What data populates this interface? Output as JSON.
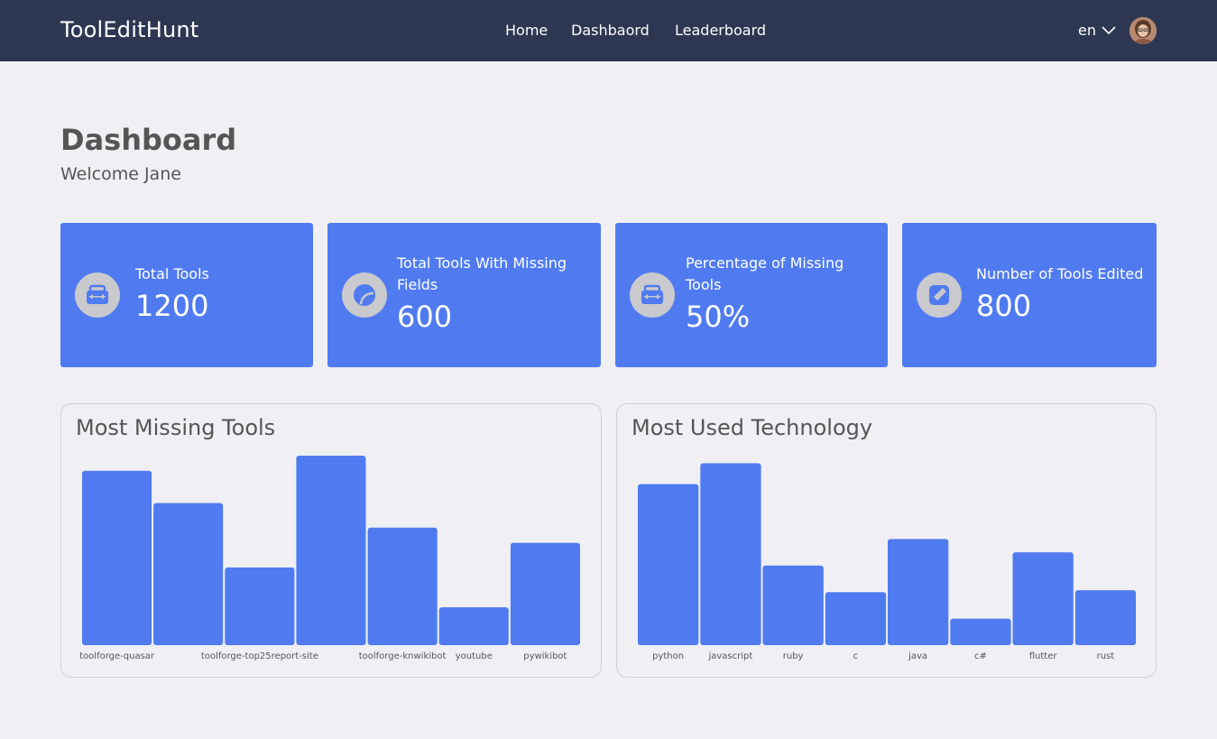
{
  "app": {
    "brand": "ToolEditHunt"
  },
  "nav": {
    "items": [
      "Home",
      "Dashbaord",
      "Leaderboard"
    ]
  },
  "lang": {
    "value": "en"
  },
  "page": {
    "title": "Dashboard",
    "welcome": "Welcome Jane"
  },
  "colors": {
    "navbar": "#2e3752",
    "accent": "#507bf0",
    "icon_bg": "#c9c9ce",
    "background": "#f0f0f4"
  },
  "cards": [
    {
      "label": "Total Tools",
      "value": "1200",
      "icon": "toolbox-icon"
    },
    {
      "label": "Total Tools With Missing Fields",
      "value": "600",
      "icon": "pie-chart-icon"
    },
    {
      "label": "Percentage of Missing Tools",
      "value": "50%",
      "icon": "toolbox-icon"
    },
    {
      "label": "Number of Tools Edited",
      "value": "800",
      "icon": "edit-icon"
    }
  ],
  "chart_data": [
    {
      "type": "bar",
      "title": "Most Missing Tools",
      "categories": [
        "toolforge-quasar",
        "",
        "toolforge-top25report-site",
        "",
        "toolforge-knwikibot",
        "youtube",
        "pywikibot"
      ],
      "values": [
        92,
        75,
        41,
        100,
        62,
        20,
        54
      ],
      "ylim": [
        0,
        100
      ],
      "grid": false,
      "legend": "none"
    },
    {
      "type": "bar",
      "title": "Most Used Technology",
      "categories": [
        "python",
        "javascript",
        "ruby",
        "c",
        "java",
        "c#",
        "flutter",
        "rust"
      ],
      "values": [
        85,
        96,
        42,
        28,
        56,
        14,
        49,
        29
      ],
      "ylim": [
        0,
        100
      ],
      "grid": false,
      "legend": "none"
    }
  ]
}
